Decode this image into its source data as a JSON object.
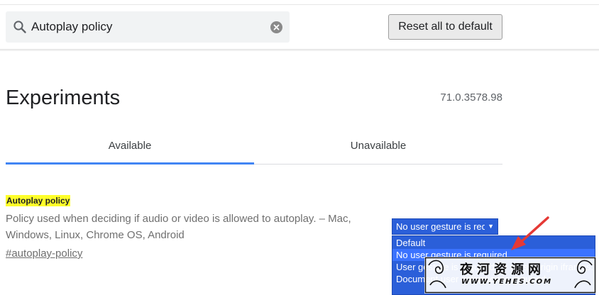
{
  "search": {
    "value": "Autoplay policy",
    "icon": "search-icon",
    "clear_icon": "clear-icon"
  },
  "toolbar": {
    "reset_label": "Reset all to default"
  },
  "header": {
    "title": "Experiments",
    "version": "71.0.3578.98"
  },
  "tabs": [
    {
      "label": "Available",
      "active": true
    },
    {
      "label": "Unavailable",
      "active": false
    }
  ],
  "experiment": {
    "title": "Autoplay policy",
    "description": "Policy used when deciding if audio or video is allowed to autoplay. – Mac, Windows, Linux, Chrome OS, Android",
    "link": "#autoplay-policy",
    "select": {
      "selected": "No user gesture is required",
      "options": [
        "Default",
        "No user gesture is required",
        "User gesture is required for cross-origin iframes.",
        "Document user activation is required."
      ],
      "hovered_index": 1
    }
  },
  "watermark": {
    "text": "夜河资源网",
    "url": "WWW.YEHES.COM"
  },
  "colors": {
    "accent": "#4285f4",
    "highlight": "#ffff2a",
    "select_bg": "#2b5fd9",
    "arrow": "#e53935"
  }
}
